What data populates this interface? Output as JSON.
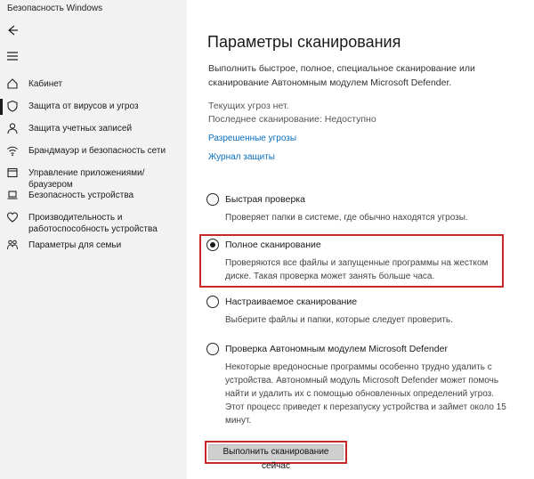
{
  "window": {
    "title": "Безопасность Windows"
  },
  "sidebar": {
    "items": [
      {
        "label": "Кабинет",
        "icon": "home-icon",
        "active": false
      },
      {
        "label": "Защита от вирусов и угроз",
        "icon": "shield-icon",
        "active": true
      },
      {
        "label": "Защита учетных записей",
        "icon": "person-icon",
        "active": false
      },
      {
        "label": "Брандмауэр и безопасность сети",
        "icon": "wifi-icon",
        "active": false
      },
      {
        "label": "Управление приложениями/браузером",
        "icon": "browser-icon",
        "active": false
      },
      {
        "label": "Безопасность устройства",
        "icon": "laptop-icon",
        "active": false
      },
      {
        "label": "Производительность и работоспособность устройства",
        "icon": "heart-icon",
        "active": false
      },
      {
        "label": "Параметры для семьи",
        "icon": "family-icon",
        "active": false
      }
    ]
  },
  "main": {
    "title": "Параметры сканирования",
    "description": "Выполнить быстрое, полное, специальное сканирование или сканирование Автономным модулем Microsoft Defender.",
    "current_threats": "Текущих угроз нет.",
    "last_scan": "Последнее сканирование: Недоступно",
    "links": {
      "allowed_threats": "Разрешенные угрозы",
      "protection_history": "Журнал защиты"
    },
    "options": [
      {
        "label": "Быстрая проверка",
        "description": "Проверяет папки в системе, где обычно находятся угрозы.",
        "checked": false
      },
      {
        "label": "Полное сканирование",
        "description": "Проверяются все файлы и запущенные программы на жестком диске. Такая проверка может занять больше часа.",
        "checked": true
      },
      {
        "label": "Настраиваемое сканирование",
        "description": "Выберите файлы и папки, которые следует проверить.",
        "checked": false
      },
      {
        "label": "Проверка Автономным модулем Microsoft Defender",
        "description": "Некоторые вредоносные программы особенно трудно удалить с устройства. Автономный модуль Microsoft Defender может помочь найти и удалить их с помощью обновленных определений угроз. Этот процесс приведет к перезапуску устройства и займет около 15 минут.",
        "checked": false
      }
    ],
    "scan_button": "Выполнить сканирование сейчас"
  },
  "colors": {
    "link": "#0a6fc0",
    "highlight": "#c62828",
    "sidebar_bg": "#f2f2f2"
  }
}
